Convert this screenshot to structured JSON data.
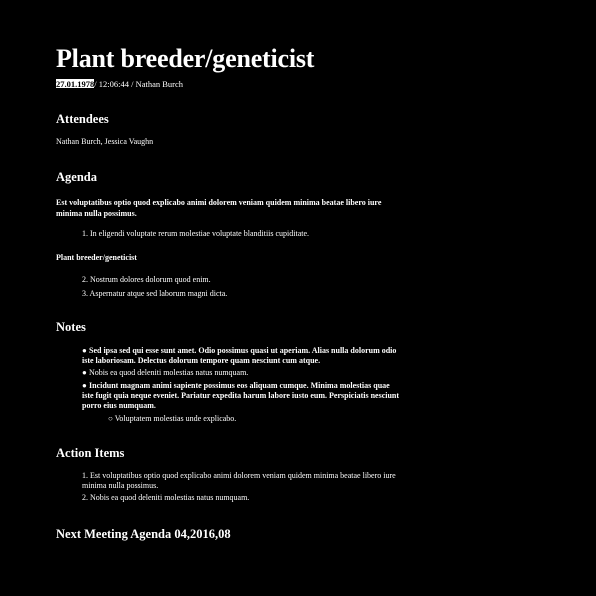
{
  "doc": {
    "title": "Plant breeder/geneticist",
    "date": "27.01.1978",
    "meta_rest": "/ 12:06:44 / Nathan Burch"
  },
  "attendees": {
    "heading": "Attendees",
    "names": "Nathan Burch, Jessica Vaughn"
  },
  "agenda": {
    "heading": "Agenda",
    "intro": "Est voluptatibus optio quod explicabo animi dolorem veniam quidem minima beatae libero iure minima nulla possimus.",
    "item1": "1. In eligendi voluptate rerum molestiae voluptate blanditiis cupiditate.",
    "subheading": "Plant breeder/geneticist",
    "item2": "2. Nostrum dolores dolorum quod enim.",
    "item3": "3. Aspernatur atque sed laborum magni dicta."
  },
  "notes": {
    "heading": "Notes",
    "bullet1": "Sed ipsa sed qui esse sunt amet. Odio possimus quasi ut aperiam. Alias nulla dolorum odio iste laboriosam. Delectus dolorum tempore quam nesciunt cum atque.",
    "bullet2": "Nobis ea quod deleniti molestias natus numquam.",
    "bullet3": "Incidunt magnam animi sapiente possimus eos aliquam cumque. Minima molestias quae iste fugit quia neque eveniet. Pariatur expedita harum labore iusto eum. Perspiciatis nesciunt porro eius numquam.",
    "sub_bullet": "Voluptatem molestias unde explicabo."
  },
  "action_items": {
    "heading": "Action Items",
    "item1": "1. Est voluptatibus optio quod explicabo animi dolorem veniam quidem minima beatae libero iure minima nulla possimus.",
    "item2": "2. Nobis ea quod deleniti molestias natus numquam."
  },
  "next_meeting": {
    "heading": "Next Meeting Agenda 04,2016,08"
  }
}
